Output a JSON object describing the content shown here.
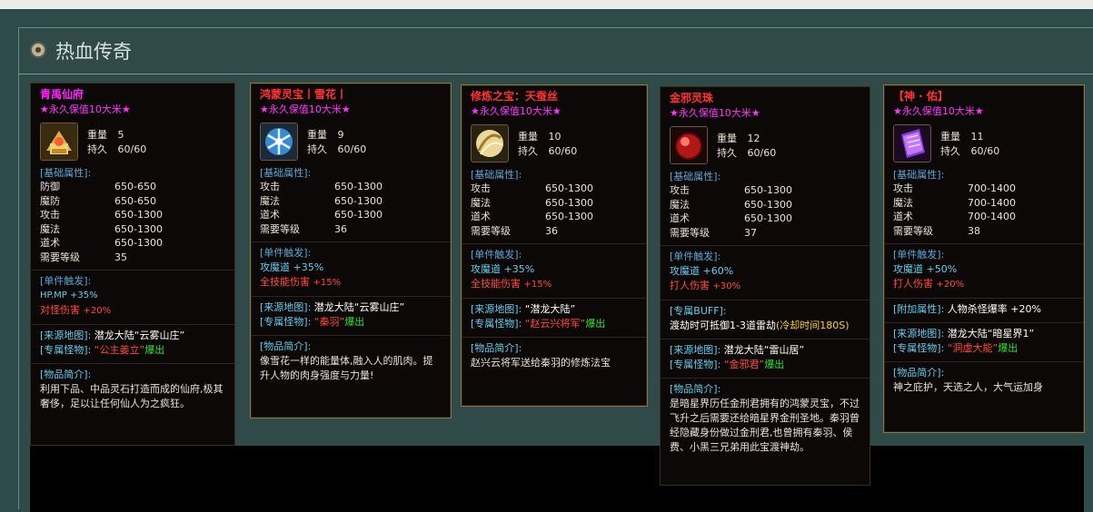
{
  "window": {
    "title": "热血传奇"
  },
  "common": {
    "perm": "★永久保值10大米★",
    "weight_label": "重量",
    "durability_label": "持久",
    "basic_attr_label": "[基础属性]:",
    "single_trigger_label": "[单件触发]:",
    "source_map_label": "[来源地图]:",
    "monster_label": "[专属怪物]:",
    "intro_label": "[物品简介]:",
    "level_label": "需要等级",
    "drop_label": "爆出"
  },
  "cards": [
    {
      "name": "青禹仙府",
      "name_color": "#ff22ff",
      "weight": "5",
      "durability": "60/60",
      "attrs": [
        {
          "k": "防御",
          "v": "650-650"
        },
        {
          "k": "魔防",
          "v": "650-650"
        },
        {
          "k": "攻击",
          "v": "650-1300"
        },
        {
          "k": "魔法",
          "v": "650-1300"
        },
        {
          "k": "道术",
          "v": "650-1300"
        },
        {
          "k": "需要等级",
          "v": "35"
        }
      ],
      "trigger_1": "HP.MP +35%",
      "trigger_2_label": "对怪伤害",
      "trigger_2_value": "+20%",
      "source_map": "潜龙大陆“云雾山庄”",
      "monster": "“公主姜立”",
      "intro": "利用下品、中品灵石打造而成的仙府,极其奢侈，足以让任何仙人为之疯狂。"
    },
    {
      "name": "鸿蒙灵宝丨雪花丨",
      "name_color": "#ff3333",
      "weight": "9",
      "durability": "60/60",
      "attrs": [
        {
          "k": "攻击",
          "v": "650-1300"
        },
        {
          "k": "魔法",
          "v": "650-1300"
        },
        {
          "k": "道术",
          "v": "650-1300"
        },
        {
          "k": "需要等级",
          "v": "36"
        }
      ],
      "trigger_1": "攻魔道 +35%",
      "trigger_2_label": "全技能伤害",
      "trigger_2_value": "+15%",
      "source_map": "潜龙大陆“云雾山庄”",
      "monster": "“秦羽”",
      "intro": "像雪花一样的能量体,融入人的肌肉。提升人物的肉身强度与力量!"
    },
    {
      "name": "修炼之宝：天蚕丝",
      "name_color": "#ff3333",
      "weight": "10",
      "durability": "60/60",
      "attrs": [
        {
          "k": "攻击",
          "v": "650-1300"
        },
        {
          "k": "魔法",
          "v": "650-1300"
        },
        {
          "k": "道术",
          "v": "650-1300"
        },
        {
          "k": "需要等级",
          "v": "36"
        }
      ],
      "trigger_1": "攻魔道 +35%",
      "trigger_2_label": "全技能伤害",
      "trigger_2_value": "+15%",
      "source_map": "“潜龙大陆”",
      "monster": "“赵云兴将军”",
      "intro": "赵兴云将军送给秦羽的修炼法宝"
    },
    {
      "name": "金邪灵珠",
      "name_color": "#ff3333",
      "weight": "12",
      "durability": "60/60",
      "attrs": [
        {
          "k": "攻击",
          "v": "650-1300"
        },
        {
          "k": "魔法",
          "v": "650-1300"
        },
        {
          "k": "道术",
          "v": "650-1300"
        },
        {
          "k": "需要等级",
          "v": "37"
        }
      ],
      "trigger_1": "攻魔道 +60%",
      "trigger_2_label": "打人伤害",
      "trigger_2_value": "+30%",
      "buff_label": "[专属BUFF]:",
      "buff_text": "渡劫时可抵御1-3道雷劫",
      "buff_cd": "(冷却时间180S)",
      "source_map": "潜龙大陆“雷山居”",
      "monster": "“金邪君”",
      "intro": "是暗星界历任金刑君拥有的鸿蒙灵宝，不过飞升之后需要还给暗星界金刑圣地。秦羽曾经隐藏身份做过金刑君,也曾拥有秦羽、侯费、小黑三兄弟用此宝渡神劫。"
    },
    {
      "name": "【神 · 佑】",
      "name_color": "#ff3333",
      "weight": "11",
      "durability": "60/60",
      "attrs": [
        {
          "k": "攻击",
          "v": "700-1400"
        },
        {
          "k": "魔法",
          "v": "700-1400"
        },
        {
          "k": "道术",
          "v": "700-1400"
        },
        {
          "k": "需要等级",
          "v": "38"
        }
      ],
      "trigger_1": "攻魔道 +50%",
      "trigger_2_label": "打人伤害",
      "trigger_2_value": "+20%",
      "extra_label": "[附加属性]:",
      "extra_text": "人物杀怪爆率 +20%",
      "source_map": "潜龙大陆“暗星界1”",
      "monster": "“洞虚大能”",
      "intro": "神之庇护，天选之人，大气运加身"
    }
  ]
}
